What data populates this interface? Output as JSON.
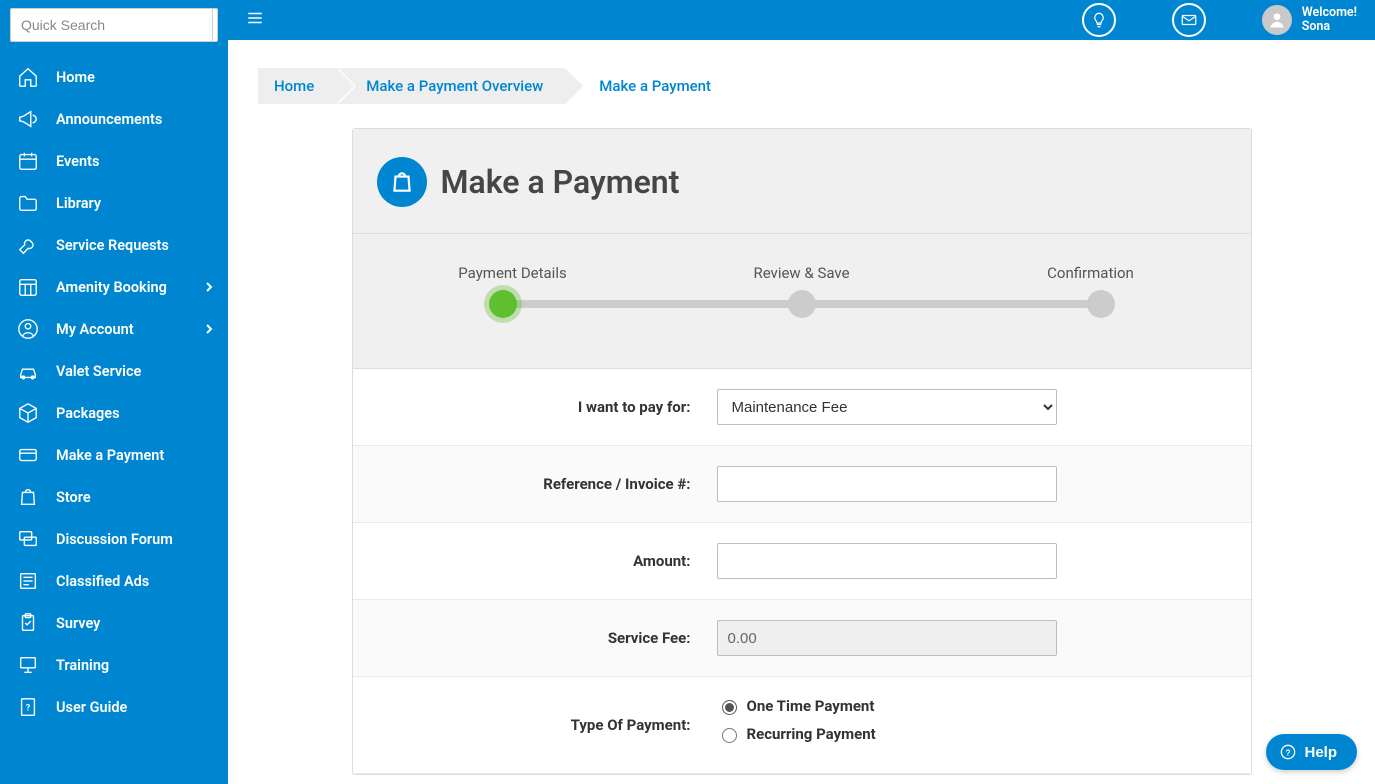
{
  "search": {
    "placeholder": "Quick Search"
  },
  "sidebar": {
    "items": [
      {
        "label": "Home"
      },
      {
        "label": "Announcements"
      },
      {
        "label": "Events"
      },
      {
        "label": "Library"
      },
      {
        "label": "Service Requests"
      },
      {
        "label": "Amenity Booking",
        "expandable": true
      },
      {
        "label": "My Account",
        "expandable": true
      },
      {
        "label": "Valet Service"
      },
      {
        "label": "Packages"
      },
      {
        "label": "Make a Payment"
      },
      {
        "label": "Store"
      },
      {
        "label": "Discussion Forum"
      },
      {
        "label": "Classified Ads"
      },
      {
        "label": "Survey"
      },
      {
        "label": "Training"
      },
      {
        "label": "User Guide"
      }
    ]
  },
  "topbar": {
    "welcome_line1": "Welcome!",
    "welcome_line2": "Sona"
  },
  "breadcrumb": {
    "items": [
      "Home",
      "Make a Payment Overview",
      "Make a Payment"
    ]
  },
  "page": {
    "title": "Make a Payment",
    "steps": [
      "Payment Details",
      "Review & Save",
      "Confirmation"
    ],
    "active_step": 0
  },
  "form": {
    "pay_for": {
      "label": "I want to pay for:",
      "value": "Maintenance Fee"
    },
    "reference": {
      "label": "Reference / Invoice #:",
      "value": ""
    },
    "amount": {
      "label": "Amount:",
      "value": ""
    },
    "service_fee": {
      "label": "Service Fee:",
      "value": "0.00"
    },
    "payment_type": {
      "label": "Type Of Payment:",
      "options": [
        "One Time Payment",
        "Recurring Payment"
      ],
      "selected": "One Time Payment"
    }
  },
  "help": {
    "label": "Help"
  }
}
